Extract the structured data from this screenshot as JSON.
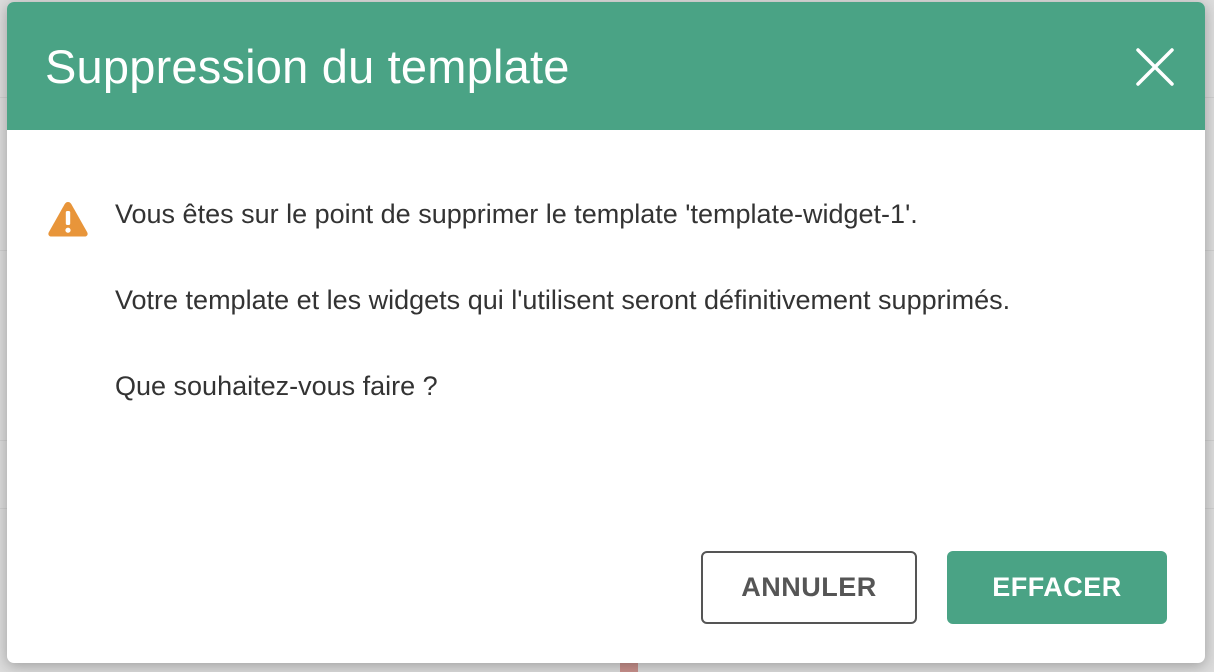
{
  "dialog": {
    "title": "Suppression du template",
    "close_icon": "close-icon",
    "warning_icon": "warning-triangle-icon",
    "messages": [
      "Vous êtes sur le point de supprimer le template 'template-widget-1'.",
      "Votre template et les widgets qui l'utilisent seront définitivement supprimés.",
      "Que souhaitez-vous faire ?"
    ],
    "buttons": {
      "cancel_label": "ANNULER",
      "confirm_label": "EFFACER"
    }
  },
  "colors": {
    "header_bg": "#4aa385",
    "confirm_bg": "#4aa385",
    "warning": "#e8953a",
    "text": "#333333"
  }
}
